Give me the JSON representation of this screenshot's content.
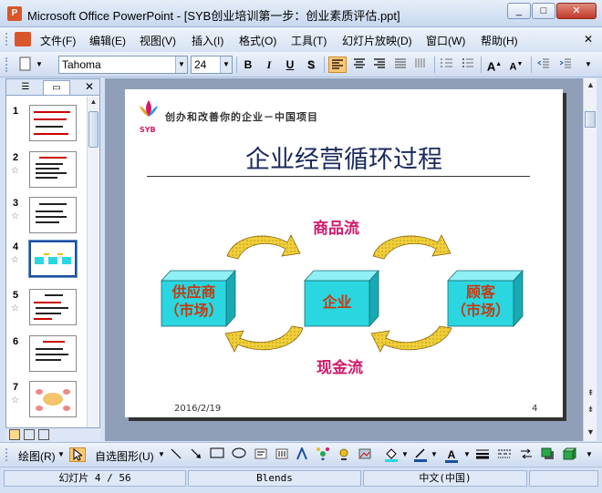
{
  "window": {
    "title": "Microsoft Office PowerPoint - [SYB创业培训第一步：创业素质评估.ppt]",
    "min": "_",
    "max": "□",
    "close": "✕"
  },
  "menu": [
    "文件(F)",
    "编辑(E)",
    "视图(V)",
    "插入(I)",
    "格式(O)",
    "工具(T)",
    "幻灯片放映(D)",
    "窗口(W)",
    "帮助(H)"
  ],
  "toolbar": {
    "font": "Tahoma",
    "size": "24",
    "bold": "B",
    "italic": "I",
    "underline": "U",
    "shadow": "S"
  },
  "pane": {
    "tab_outline": "☰",
    "tab_slides": "▭",
    "close": "✕",
    "slides": [
      {
        "num": "1",
        "star": ""
      },
      {
        "num": "2",
        "star": "☆"
      },
      {
        "num": "3",
        "star": "☆"
      },
      {
        "num": "4",
        "star": "☆"
      },
      {
        "num": "5",
        "star": "☆"
      },
      {
        "num": "6",
        "star": ""
      },
      {
        "num": "7",
        "star": "☆"
      }
    ]
  },
  "slide": {
    "logo": "SYB",
    "org": "创办和改善你的企业－中国项目",
    "title": "企业经营循环过程",
    "flow_top": "商品流",
    "flow_bottom": "现金流",
    "supplier": "供应商\n（市场）",
    "enterprise": "企业",
    "customer": "顾客\n（市场）",
    "date": "2016/2/19",
    "page": "4"
  },
  "drawbar": {
    "draw": "绘图(R)",
    "autoshapes": "自选图形(U)"
  },
  "status": {
    "slide": "幻灯片 4 / 56",
    "design": "Blends",
    "lang": "中文(中国)"
  },
  "colors": {
    "flow_text": "#d11a6a",
    "box_face": "#2ad6e0",
    "box_label": "#c23b12",
    "arrow": "#e8c020"
  }
}
